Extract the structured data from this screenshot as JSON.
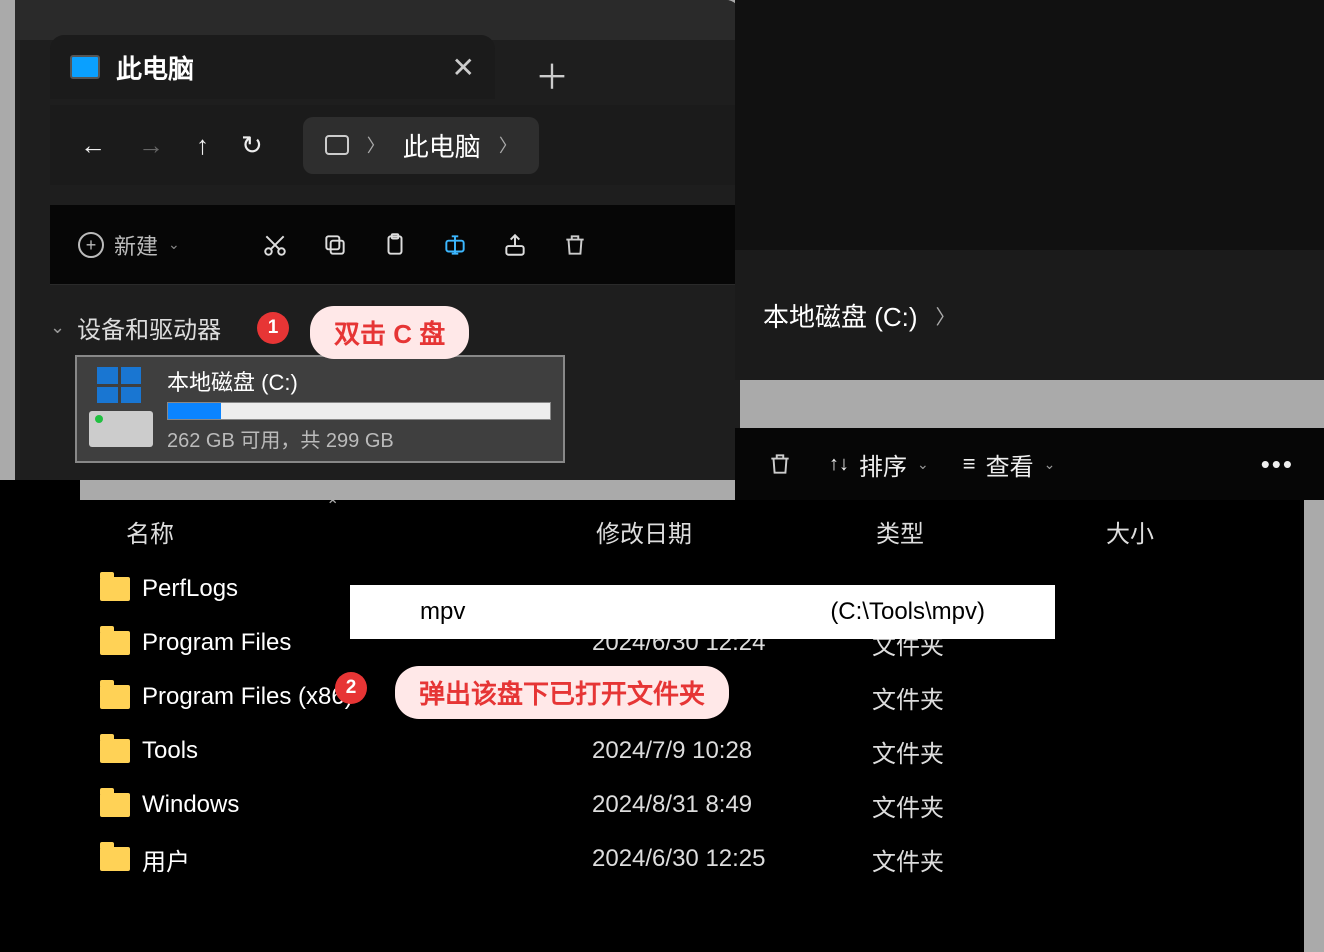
{
  "tab": {
    "title": "此电脑"
  },
  "breadcrumb1": {
    "label": "此电脑"
  },
  "toolbar1": {
    "new": "新建"
  },
  "section": {
    "label": "设备和驱动器"
  },
  "drive": {
    "name": "本地磁盘 (C:)",
    "size": "262 GB 可用，共 299 GB"
  },
  "annotations": {
    "b1": "1",
    "bub1": "双击 C 盘",
    "b2": "2",
    "bub2": "弹出该盘下已打开文件夹"
  },
  "breadcrumb2": {
    "label": "本地磁盘 (C:)"
  },
  "toolbar2": {
    "sort": "排序",
    "view": "查看"
  },
  "columns": {
    "name": "名称",
    "date": "修改日期",
    "type": "类型",
    "size": "大小"
  },
  "popup": {
    "name": "mpv",
    "path": "(C:\\Tools\\mpv)"
  },
  "rows": [
    {
      "name": "PerfLogs",
      "date": "",
      "type": ""
    },
    {
      "name": "Program Files",
      "date": "2024/6/30 12:24",
      "type": "文件夹"
    },
    {
      "name": "Program Files (x86)",
      "date": "",
      "type": "文件夹"
    },
    {
      "name": "Tools",
      "date": "2024/7/9 10:28",
      "type": "文件夹"
    },
    {
      "name": "Windows",
      "date": "2024/8/31 8:49",
      "type": "文件夹"
    },
    {
      "name": "用户",
      "date": "2024/6/30 12:25",
      "type": "文件夹"
    }
  ]
}
